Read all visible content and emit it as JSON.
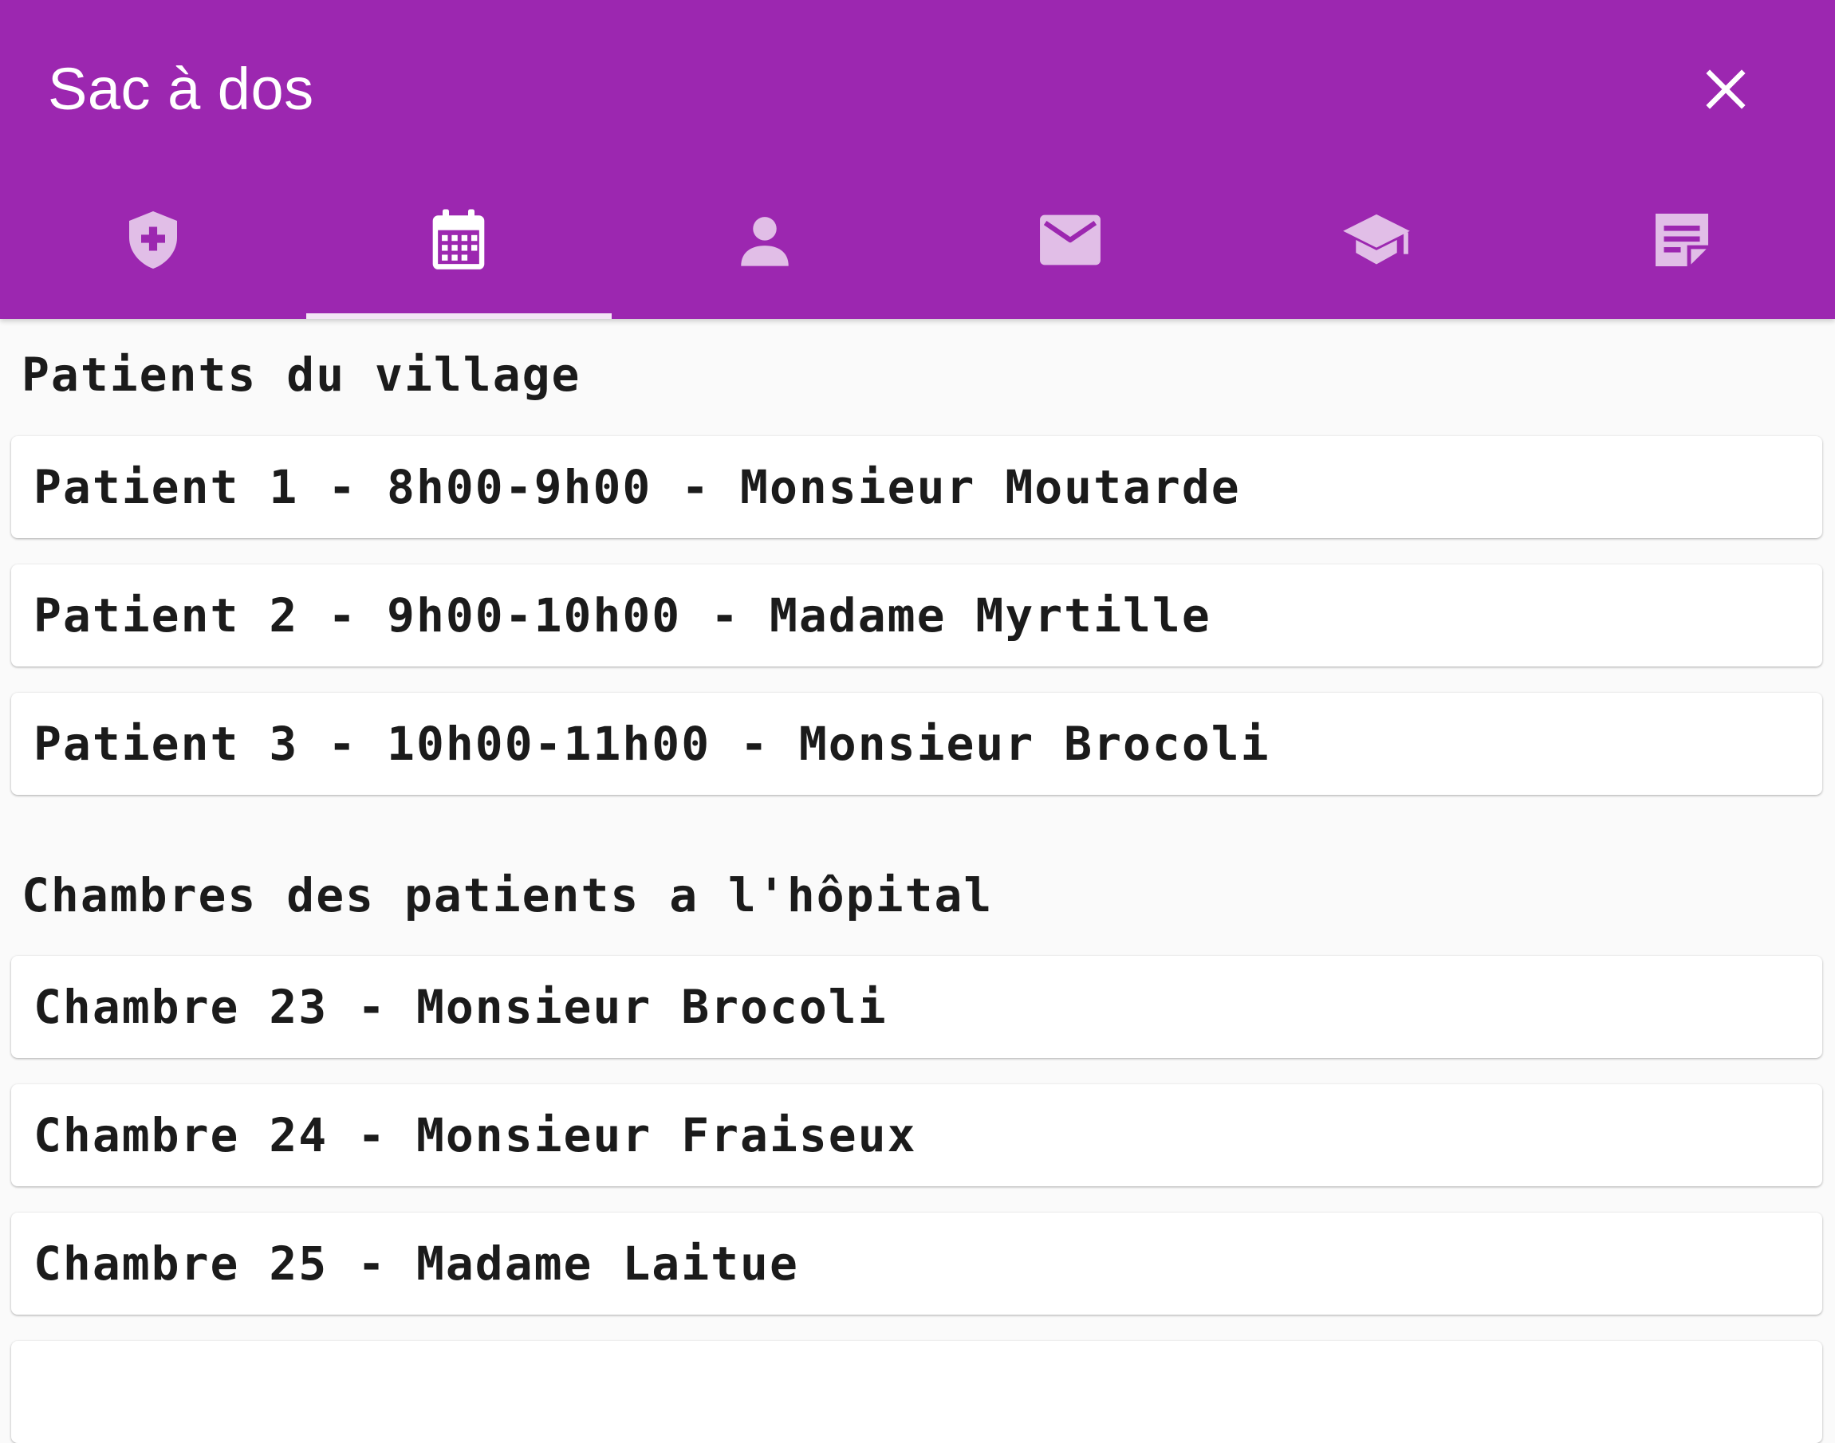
{
  "app_bar": {
    "title": "Sac à dos",
    "close_icon": "close-icon",
    "background": "#9c27b0"
  },
  "tabs": [
    {
      "icon": "shield-plus-icon",
      "active": false
    },
    {
      "icon": "calendar-icon",
      "active": true
    },
    {
      "icon": "person-icon",
      "active": false
    },
    {
      "icon": "mail-icon",
      "active": false
    },
    {
      "icon": "graduation-cap-icon",
      "active": false
    },
    {
      "icon": "note-icon",
      "active": false
    }
  ],
  "sections": [
    {
      "title": "Patients du village",
      "items": [
        "Patient 1 - 8h00-9h00 - Monsieur Moutarde",
        "Patient 2 - 9h00-10h00 - Madame Myrtille",
        "Patient 3 - 10h00-11h00 - Monsieur Brocoli"
      ]
    },
    {
      "title": "Chambres des patients a l'hôpital",
      "items": [
        "Chambre 23 - Monsieur Brocoli",
        "Chambre 24 - Monsieur Fraiseux",
        "Chambre 25 - Madame Laitue"
      ]
    }
  ]
}
